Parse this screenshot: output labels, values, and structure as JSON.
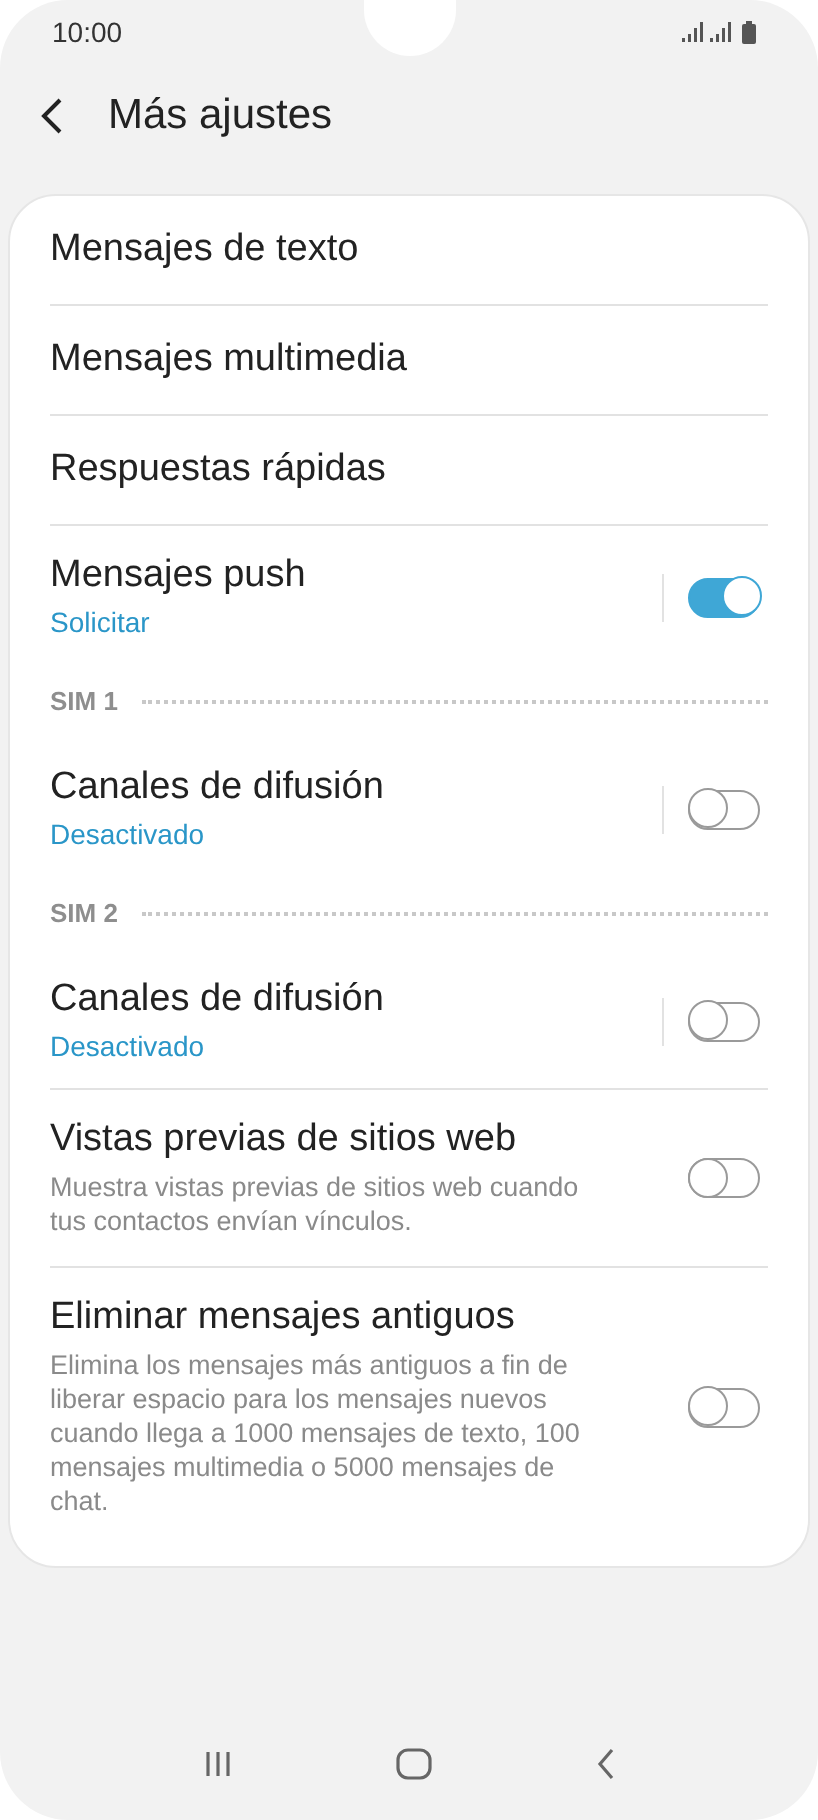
{
  "status_bar": {
    "time": "10:00"
  },
  "header": {
    "title": "Más ajustes"
  },
  "items": [
    {
      "kind": "plain",
      "title": "Mensajes de texto"
    },
    {
      "kind": "plain",
      "title": "Mensajes multimedia"
    },
    {
      "kind": "plain",
      "title": "Respuestas rápidas"
    },
    {
      "kind": "status_switch",
      "title": "Mensajes push",
      "subtitle": "Solicitar",
      "on": true
    },
    {
      "kind": "section",
      "title": "SIM 1"
    },
    {
      "kind": "status_switch",
      "title": "Canales de difusión",
      "subtitle": "Desactivado",
      "on": false
    },
    {
      "kind": "section",
      "title": "SIM 2"
    },
    {
      "kind": "status_switch",
      "title": "Canales de difusión",
      "subtitle": "Desactivado",
      "on": false
    },
    {
      "kind": "description_switch",
      "title": "Vistas previas de sitios web",
      "subtitle": "Muestra vistas previas de sitios web cuando tus contactos envían vínculos.",
      "on": false
    },
    {
      "kind": "description_switch",
      "title": "Eliminar mensajes antiguos",
      "subtitle": "Elimina los mensajes más antiguos a fin de liberar espacio para los mensajes nuevos cuando llega a 1000 mensajes de texto, 100 mensajes multimedia o 5000 mensajes de chat.",
      "on": false
    }
  ]
}
